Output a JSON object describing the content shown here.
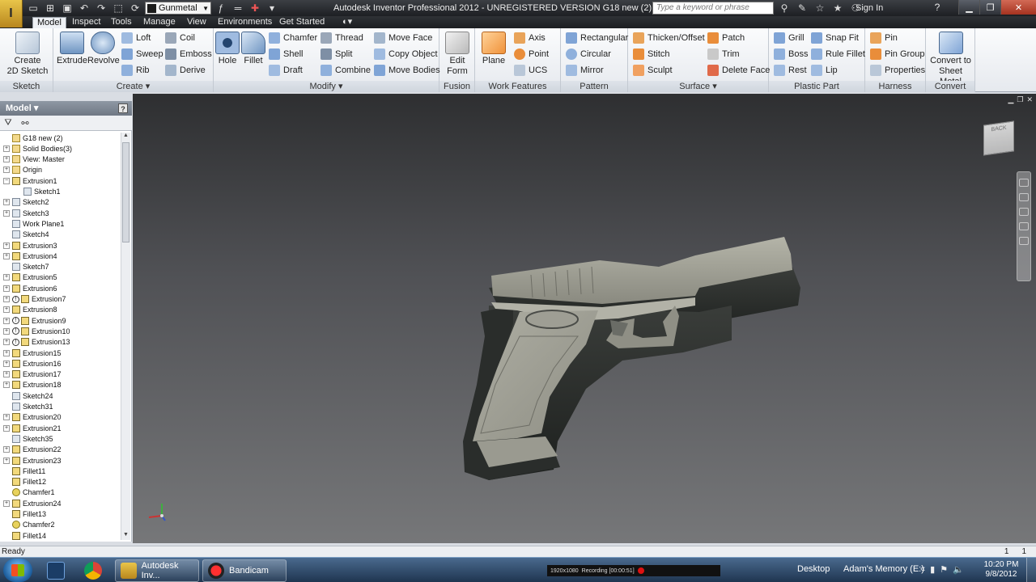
{
  "window": {
    "title": "Autodesk Inventor Professional 2012 - UNREGISTERED VERSION    G18 new (2)",
    "material": "Gunmetal",
    "search_placeholder": "Type a keyword or phrase",
    "sign_in": "Sign In"
  },
  "tabs": [
    "Model",
    "Inspect",
    "Tools",
    "Manage",
    "View",
    "Environments",
    "Get Started"
  ],
  "active_tab": "Model",
  "ribbon": {
    "sketch": {
      "label": "Sketch",
      "create_2d": "Create\n2D Sketch"
    },
    "create": {
      "label": "Create",
      "big": [
        "Extrude",
        "Revolve"
      ],
      "col1": [
        "Loft",
        "Sweep",
        "Rib"
      ],
      "col2": [
        "Coil",
        "Emboss",
        "Derive"
      ]
    },
    "modify": {
      "label": "Modify",
      "big": [
        "Hole",
        "Fillet"
      ],
      "col1": [
        "Chamfer",
        "Shell",
        "Draft"
      ],
      "col2": [
        "Thread",
        "Split",
        "Combine"
      ],
      "col3": [
        "Move Face",
        "Copy Object",
        "Move Bodies"
      ]
    },
    "fusion": {
      "label": "Fusion",
      "edit_form": "Edit\nForm"
    },
    "work_features": {
      "label": "Work Features",
      "plane": "Plane",
      "col1": [
        "Axis",
        "Point",
        "UCS"
      ]
    },
    "pattern": {
      "label": "Pattern",
      "items": [
        "Rectangular",
        "Circular",
        "Mirror"
      ]
    },
    "surface": {
      "label": "Surface",
      "col1": [
        "Thicken/Offset",
        "Stitch",
        "Sculpt"
      ],
      "col2": [
        "Patch",
        "Trim",
        "Delete Face"
      ]
    },
    "plastic_part": {
      "label": "Plastic Part",
      "col1": [
        "Grill",
        "Boss",
        "Rest"
      ],
      "col2": [
        "Snap Fit",
        "Rule Fillet",
        "Lip"
      ]
    },
    "harness": {
      "label": "Harness",
      "items": [
        "Pin",
        "Pin Group",
        "Properties"
      ]
    },
    "convert": {
      "label": "Convert",
      "sheet_metal": "Convert to\nSheet Metal"
    }
  },
  "browser": {
    "header": "Model",
    "help": "?",
    "tree": [
      {
        "label": "G18 new (2)",
        "type": "root",
        "exp": false,
        "warn": false
      },
      {
        "label": "Solid Bodies(3)",
        "type": "folder",
        "exp": true,
        "warn": false
      },
      {
        "label": "View: Master",
        "type": "folder",
        "exp": true,
        "warn": false
      },
      {
        "label": "Origin",
        "type": "folder",
        "exp": true,
        "warn": false
      },
      {
        "label": "Extrusion1",
        "type": "feat",
        "exp": true,
        "warn": false,
        "open": true
      },
      {
        "label": "Sketch1",
        "type": "sketch",
        "exp": false,
        "warn": false,
        "indent": 1
      },
      {
        "label": "Sketch2",
        "type": "sketch",
        "exp": true,
        "warn": false
      },
      {
        "label": "Sketch3",
        "type": "sketch",
        "exp": true,
        "warn": false
      },
      {
        "label": "Work Plane1",
        "type": "sketch",
        "exp": false,
        "warn": false
      },
      {
        "label": "Sketch4",
        "type": "sketch",
        "exp": false,
        "warn": false
      },
      {
        "label": "Extrusion3",
        "type": "feat",
        "exp": true,
        "warn": false
      },
      {
        "label": "Extrusion4",
        "type": "feat",
        "exp": true,
        "warn": false
      },
      {
        "label": "Sketch7",
        "type": "sketch",
        "exp": false,
        "warn": false
      },
      {
        "label": "Extrusion5",
        "type": "feat",
        "exp": true,
        "warn": false
      },
      {
        "label": "Extrusion6",
        "type": "feat",
        "exp": true,
        "warn": false
      },
      {
        "label": "Extrusion7",
        "type": "feat",
        "exp": true,
        "warn": true
      },
      {
        "label": "Extrusion8",
        "type": "feat",
        "exp": true,
        "warn": false
      },
      {
        "label": "Extrusion9",
        "type": "feat",
        "exp": true,
        "warn": true
      },
      {
        "label": "Extrusion10",
        "type": "feat",
        "exp": true,
        "warn": true
      },
      {
        "label": "Extrusion13",
        "type": "feat",
        "exp": true,
        "warn": true
      },
      {
        "label": "Extrusion15",
        "type": "feat",
        "exp": true,
        "warn": false
      },
      {
        "label": "Extrusion16",
        "type": "feat",
        "exp": true,
        "warn": false
      },
      {
        "label": "Extrusion17",
        "type": "feat",
        "exp": true,
        "warn": false
      },
      {
        "label": "Extrusion18",
        "type": "feat",
        "exp": true,
        "warn": false
      },
      {
        "label": "Sketch24",
        "type": "sketch",
        "exp": false,
        "warn": false
      },
      {
        "label": "Sketch31",
        "type": "sketch",
        "exp": false,
        "warn": false
      },
      {
        "label": "Extrusion20",
        "type": "feat",
        "exp": true,
        "warn": false
      },
      {
        "label": "Extrusion21",
        "type": "feat",
        "exp": true,
        "warn": false
      },
      {
        "label": "Sketch35",
        "type": "sketch",
        "exp": false,
        "warn": false
      },
      {
        "label": "Extrusion22",
        "type": "feat",
        "exp": true,
        "warn": false
      },
      {
        "label": "Extrusion23",
        "type": "feat",
        "exp": true,
        "warn": false
      },
      {
        "label": "Fillet11",
        "type": "fillet",
        "exp": false,
        "warn": false
      },
      {
        "label": "Fillet12",
        "type": "fillet",
        "exp": false,
        "warn": false
      },
      {
        "label": "Chamfer1",
        "type": "chamfer",
        "exp": false,
        "warn": false
      },
      {
        "label": "Extrusion24",
        "type": "feat",
        "exp": true,
        "warn": false
      },
      {
        "label": "Fillet13",
        "type": "fillet",
        "exp": false,
        "warn": false
      },
      {
        "label": "Chamfer2",
        "type": "chamfer",
        "exp": false,
        "warn": false
      },
      {
        "label": "Fillet14",
        "type": "fillet",
        "exp": false,
        "warn": false
      }
    ]
  },
  "viewcube_label": "BACK",
  "status": {
    "text": "Ready",
    "n1": "1",
    "n2": "1"
  },
  "taskbar": {
    "tasks": [
      "Autodesk Inv...",
      "Bandicam"
    ],
    "bandicam_size": "1920x1080",
    "bandicam_rec": "Recording [00:00:51]",
    "desktop": "Desktop",
    "drive": "Adam's Memory (E:)",
    "time": "10:20 PM",
    "date": "9/8/2012"
  },
  "colors": {
    "accent": "#2f6fb6",
    "feature_icon": "#f2d97c",
    "viewport_top": "#2e2f31",
    "viewport_bottom": "#767779",
    "gun_body": "#9a9a90"
  }
}
